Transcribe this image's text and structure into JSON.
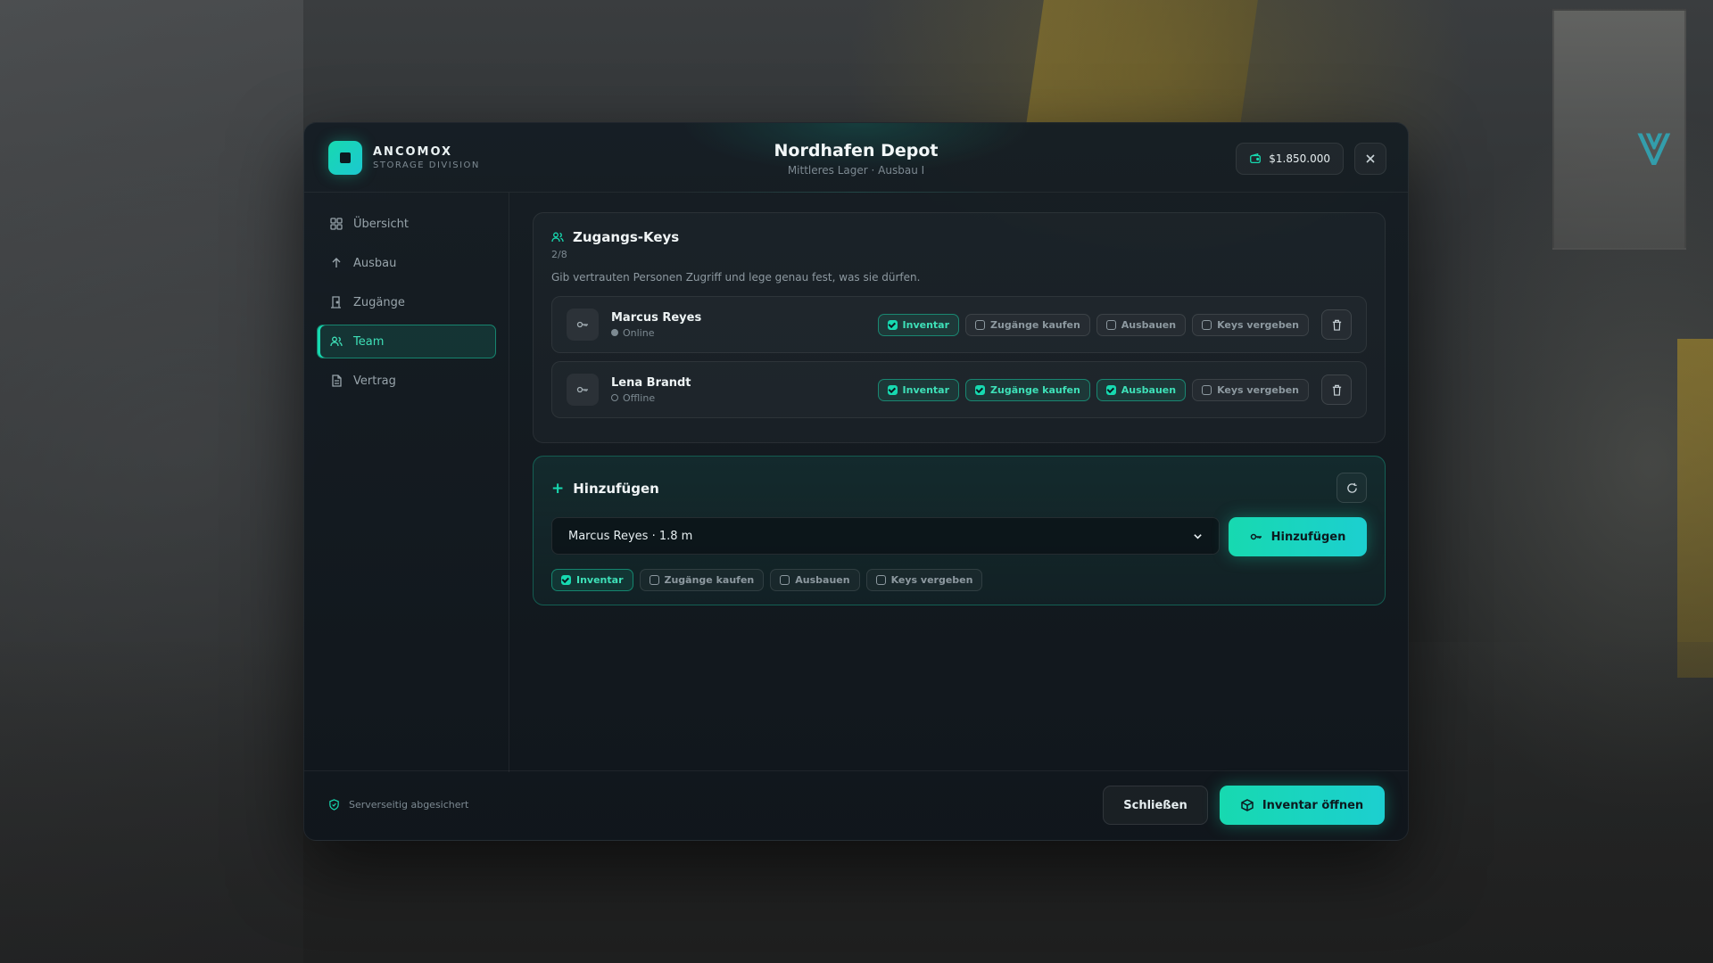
{
  "brand": {
    "name": "ANCOMOX",
    "sub": "STORAGE DIVISION",
    "logo_icon": "square-icon"
  },
  "header": {
    "title": "Nordhafen Depot",
    "subtitle": "Mittleres Lager · Ausbau I",
    "balance": "$1.850.000",
    "balance_icon": "wallet-icon",
    "close_icon": "close-icon"
  },
  "sidebar": {
    "items": [
      {
        "label": "Übersicht",
        "icon": "grid-icon",
        "active": false
      },
      {
        "label": "Ausbau",
        "icon": "arrow-up-icon",
        "active": false
      },
      {
        "label": "Zugänge",
        "icon": "door-icon",
        "active": false
      },
      {
        "label": "Team",
        "icon": "users-icon",
        "active": true
      },
      {
        "label": "Vertrag",
        "icon": "document-icon",
        "active": false
      }
    ]
  },
  "keys": {
    "title": "Zugangs-Keys",
    "count": "2/8",
    "description": "Gib vertrauten Personen Zugriff und lege genau fest, was sie dürfen.",
    "members": [
      {
        "name": "Marcus Reyes",
        "status": "Online",
        "perms": [
          {
            "label": "Inventar",
            "on": true
          },
          {
            "label": "Zugänge kaufen",
            "on": false
          },
          {
            "label": "Ausbauen",
            "on": false
          },
          {
            "label": "Keys vergeben",
            "on": false
          }
        ]
      },
      {
        "name": "Lena Brandt",
        "status": "Offline",
        "perms": [
          {
            "label": "Inventar",
            "on": true
          },
          {
            "label": "Zugänge kaufen",
            "on": true
          },
          {
            "label": "Ausbauen",
            "on": true
          },
          {
            "label": "Keys vergeben",
            "on": false
          }
        ]
      }
    ]
  },
  "add": {
    "title": "Hinzufügen",
    "selected_player": "Marcus Reyes · 1.8 m",
    "button_label": "Hinzufügen",
    "perms": [
      {
        "label": "Inventar",
        "on": true
      },
      {
        "label": "Zugänge kaufen",
        "on": false
      },
      {
        "label": "Ausbauen",
        "on": false
      },
      {
        "label": "Keys vergeben",
        "on": false
      }
    ]
  },
  "footer": {
    "secure_text": "Serverseitig abgesichert",
    "close_label": "Schließen",
    "open_inventory_label": "Inventar öffnen"
  },
  "colors": {
    "accent": "#17d9b0",
    "accent2": "#1ccfd0",
    "panel": "#161e24"
  }
}
